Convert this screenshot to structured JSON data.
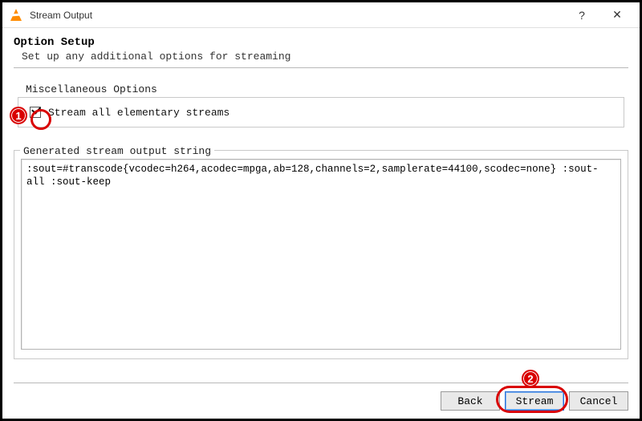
{
  "window": {
    "title": "Stream Output",
    "help_glyph": "?",
    "close_glyph": "✕"
  },
  "header": {
    "title": "Option Setup",
    "subtitle": "Set up any additional options for streaming"
  },
  "misc": {
    "group_label": "Miscellaneous Options",
    "checkbox_label": "Stream all elementary streams",
    "checkbox_checked": true
  },
  "generated": {
    "group_label": "Generated stream output string",
    "value": ":sout=#transcode{vcodec=h264,acodec=mpga,ab=128,channels=2,samplerate=44100,scodec=none} :sout-all :sout-keep"
  },
  "buttons": {
    "back": "Back",
    "stream": "Stream",
    "cancel": "Cancel"
  },
  "annotations": {
    "badge1": "1",
    "badge2": "2"
  }
}
